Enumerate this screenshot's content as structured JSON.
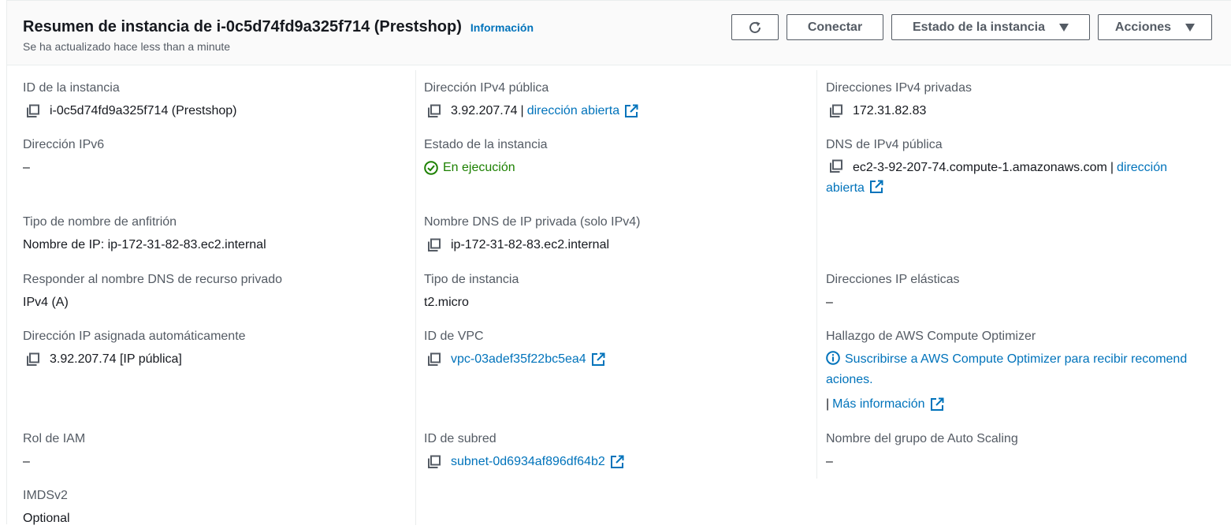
{
  "header": {
    "title": "Resumen de instancia de i-0c5d74fd9a325f714 (Prestshop)",
    "info_link": "Información",
    "updated_text": "Se ha actualizado hace less than a minute"
  },
  "actions": {
    "refresh_icon": "refresh-icon",
    "connect_label": "Conectar",
    "instance_state_label": "Estado de la instancia",
    "actions_label": "Acciones",
    "dropdown_icon": "caret-down-icon"
  },
  "fields": {
    "instance_id": {
      "label": "ID de la instancia",
      "value": "i-0c5d74fd9a325f714 (Prestshop)"
    },
    "public_ipv4": {
      "label": "Dirección IPv4 pública",
      "value": "3.92.207.74",
      "link": "dirección abierta"
    },
    "private_ipv4": {
      "label": "Direcciones IPv4 privadas",
      "value": "172.31.82.83"
    },
    "ipv6": {
      "label": "Dirección IPv6",
      "value": "–"
    },
    "instance_state": {
      "label": "Estado de la instancia",
      "value": "En ejecución"
    },
    "public_dns": {
      "label": "DNS de IPv4 pública",
      "value": "ec2-3-92-207-74.compute-1.amazonaws.com",
      "link_part1": "dirección",
      "link_part2": "abierta"
    },
    "hostname_type": {
      "label": "Tipo de nombre de anfitrión",
      "value": "Nombre de IP: ip-172-31-82-83.ec2.internal"
    },
    "private_dns": {
      "label": "Nombre DNS de IP privada (solo IPv4)",
      "value": "ip-172-31-82-83.ec2.internal"
    },
    "resource_dns": {
      "label": "Responder al nombre DNS de recurso privado",
      "value": "IPv4 (A)"
    },
    "instance_type": {
      "label": "Tipo de instancia",
      "value": "t2.micro"
    },
    "elastic_ips": {
      "label": "Direcciones IP elásticas",
      "value": "–"
    },
    "auto_ip": {
      "label": "Dirección IP asignada automáticamente",
      "value": "3.92.207.74 [IP pública]"
    },
    "vpc_id": {
      "label": "ID de VPC",
      "value": "vpc-03adef35f22bc5ea4"
    },
    "optimizer": {
      "label": "Hallazgo de AWS Compute Optimizer",
      "link_line1": "Suscribirse a AWS Compute Optimizer para recibir recomend",
      "link_line2": "aciones.",
      "more_info": "Más información"
    },
    "iam_role": {
      "label": "Rol de IAM",
      "value": "–"
    },
    "subnet_id": {
      "label": "ID de subred",
      "value": "subnet-0d6934af896df64b2"
    },
    "asg_name": {
      "label": "Nombre del grupo de Auto Scaling",
      "value": "–"
    },
    "imdsv2": {
      "label": "IMDSv2",
      "value": "Optional"
    }
  },
  "colors": {
    "link": "#0073bb",
    "running": "#1d8102",
    "label": "#545b64",
    "text": "#16191f"
  }
}
